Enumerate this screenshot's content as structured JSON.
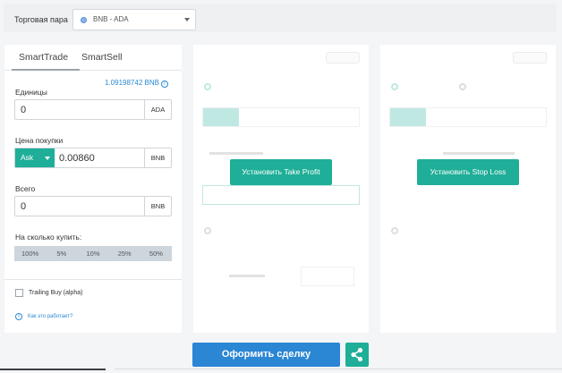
{
  "header": {
    "pair_label": "Торговая пара",
    "pair_value": "BNB - ADA"
  },
  "smarttrade": {
    "tabs": [
      "SmartTrade",
      "SmartSell"
    ],
    "available": "1.09198742 BNB",
    "units_label": "Единицы",
    "units_value": "0",
    "units_currency": "ADA",
    "price_label": "Цена покупки",
    "price_mode": "Ask",
    "price_value": "0.00860",
    "price_currency": "BNB",
    "total_label": "Всего",
    "total_value": "0",
    "total_currency": "BNB",
    "amount_label": "На сколько купить:",
    "percents": [
      "100%",
      "5%",
      "10%",
      "25%",
      "50%"
    ],
    "trailing_label": "Trailing Buy (alpha)",
    "how_link": "Как это работает?"
  },
  "take_profit": {
    "button_label": "Установить Take Profit"
  },
  "stop_loss": {
    "button_label": "Установить Stop Loss"
  },
  "footer": {
    "submit_label": "Оформить сделку"
  },
  "colors": {
    "accent_green": "#1fae98",
    "accent_blue": "#2b86d4"
  }
}
